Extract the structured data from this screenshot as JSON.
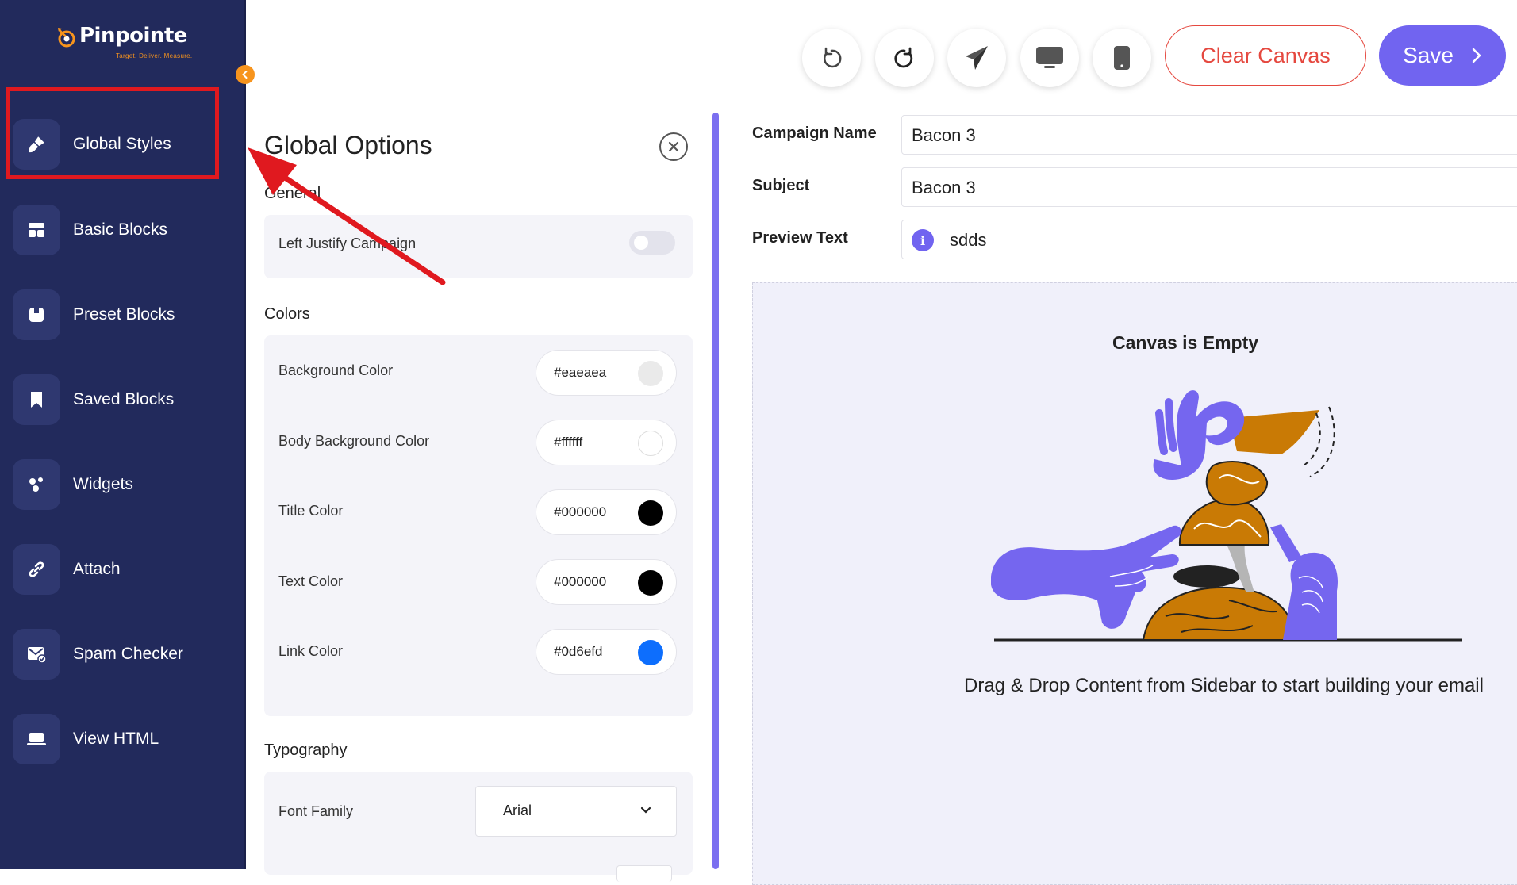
{
  "app": {
    "logo_text": "Pinpointe",
    "logo_tagline": "Target. Deliver. Measure."
  },
  "sidebar": {
    "items": [
      {
        "label": "Global Styles",
        "icon": "paint-brush-icon"
      },
      {
        "label": "Basic Blocks",
        "icon": "grid-blocks-icon"
      },
      {
        "label": "Preset Blocks",
        "icon": "preset-block-icon"
      },
      {
        "label": "Saved Blocks",
        "icon": "bookmark-icon"
      },
      {
        "label": "Widgets",
        "icon": "widgets-icon"
      },
      {
        "label": "Attach",
        "icon": "link-icon"
      },
      {
        "label": "Spam Checker",
        "icon": "mail-check-icon"
      },
      {
        "label": "View HTML",
        "icon": "laptop-icon"
      }
    ],
    "collapse_icon": "chevron-left-icon"
  },
  "toolbar": {
    "buttons": [
      "undo-icon",
      "redo-icon",
      "send-icon",
      "desktop-icon",
      "mobile-icon"
    ],
    "clear_label": "Clear Canvas",
    "save_label": "Save"
  },
  "global_options": {
    "title": "Global Options",
    "general": {
      "label": "General",
      "left_justify_label": "Left Justify Campaign",
      "left_justify_on": false
    },
    "colors": {
      "label": "Colors",
      "rows": [
        {
          "label": "Background Color",
          "value": "#eaeaea",
          "swatch": "#eaeaea"
        },
        {
          "label": "Body Background Color",
          "value": "#ffffff",
          "swatch": "#ffffff"
        },
        {
          "label": "Title Color",
          "value": "#000000",
          "swatch": "#000000"
        },
        {
          "label": "Text Color",
          "value": "#000000",
          "swatch": "#000000"
        },
        {
          "label": "Link Color",
          "value": "#0d6efd",
          "swatch": "#0d6efd"
        }
      ]
    },
    "typography": {
      "label": "Typography",
      "font_family_label": "Font Family",
      "font_family_value": "Arial"
    }
  },
  "campaign": {
    "name_label": "Campaign Name",
    "name_value": "Bacon 3",
    "subject_label": "Subject",
    "subject_value": "Bacon 3",
    "preview_label": "Preview Text",
    "preview_value": "sdds"
  },
  "canvas": {
    "empty_title": "Canvas is Empty",
    "empty_hint": "Drag & Drop Content from Sidebar to start building your email"
  },
  "colors": {
    "sidebar_bg": "#222a5c",
    "accent": "#7164f0",
    "danger": "#e5483f",
    "brand_orange": "#f7941d",
    "annotation_red": "#e0191f"
  }
}
